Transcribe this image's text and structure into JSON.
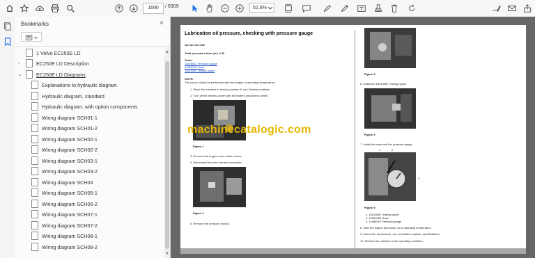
{
  "toolbar": {
    "page_current": "1690",
    "page_total": "/ 5909",
    "zoom": "52,8%"
  },
  "bookmarks": {
    "title": "Bookmarks",
    "close": "×",
    "items": [
      {
        "label": "1 Volvo EC250E LD"
      },
      {
        "label": "EC250E LD Description"
      },
      {
        "label": "EC250E LD Diagrams"
      },
      {
        "label": "Explanations to hydraulic diagram"
      },
      {
        "label": "Hydraulic diagram, standard"
      },
      {
        "label": "Hydraulic diagram, with option components"
      },
      {
        "label": "Wiring diagram SCH01-1"
      },
      {
        "label": "Wiring diagram SCH01-2"
      },
      {
        "label": "Wiring diagram SCH02-1"
      },
      {
        "label": "Wiring diagram SCH02-2"
      },
      {
        "label": "Wiring diagram SCH03-1"
      },
      {
        "label": "Wiring diagram SCH03-2"
      },
      {
        "label": "Wiring diagram SCH04"
      },
      {
        "label": "Wiring diagram SCH05-1"
      },
      {
        "label": "Wiring diagram SCH05-2"
      },
      {
        "label": "Wiring diagram SCH07-1"
      },
      {
        "label": "Wiring diagram SCH07-2"
      },
      {
        "label": "Wiring diagram SCH08-1"
      },
      {
        "label": "Wiring diagram SCH08-2"
      }
    ]
  },
  "document": {
    "title": "Lubrication oil pressure, checking with pressure gauge",
    "op_no": "Op nbr 237-032",
    "total_time": "Total procedure time (hr): 0.40",
    "tools_label": "Tools:",
    "tools": [
      "11666052 Pressure gauge",
      "14360256 Hose",
      "15019087 Testing nipple"
    ],
    "note_label": "NOTE!",
    "note_text": "The check should be performed with the engine at operating temperature.",
    "left_steps": [
      "1.   Place the machine in service position B, see Service positions.",
      "2.   Turn off the electric power with the battery disconnect switch.",
      "3.   Remove the engine room under covers.",
      "4.   Disconnect the wire-harness connector.",
      "5.   Remove the pressure sensor."
    ],
    "right_steps": [
      "6.   Install the 15019087 Testing nipple",
      "7.   Install the hose and the pressure gauge",
      "8.   Start the engine and warm up to operating temperature.",
      "9.   Check the oil pressure, see Lubrication system, specifications",
      "10.  Restore the machine to the operating condition."
    ],
    "fig_parts": [
      "1.   15019087 Testing nipple",
      "2.   14360256 Hose",
      "3.   11666052 Pressure gauge"
    ],
    "figures": [
      "Figure 1",
      "Figure 2",
      "Figure 3",
      "Figure 4",
      "Figure 5"
    ],
    "callouts": [
      "1",
      "2",
      "3"
    ]
  },
  "watermark": "machinecatalogic.com",
  "colors": {
    "watermark": "#e5b600",
    "link": "#1c4fc4",
    "viewer_bg": "#666769"
  }
}
